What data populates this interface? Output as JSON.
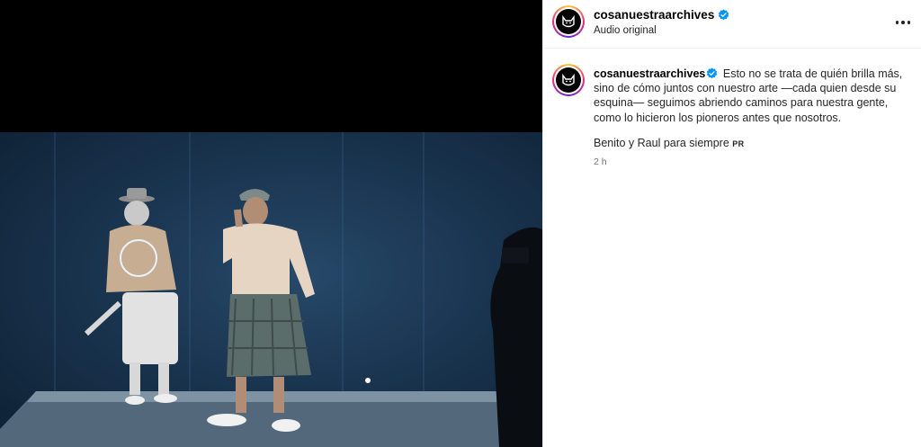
{
  "post": {
    "username": "cosanuestraarchives",
    "audio_label": "Audio original",
    "caption_text": "Esto no se trata de quién brilla más, sino de cómo juntos con nuestro arte —cada quien desde su esquina— seguimos abriendo caminos para nuestra gente, como lo hicieron los pioneros antes que nosotros.",
    "caption_line2": "Benito y Raul para siempre",
    "caption_tag": "PR",
    "timestamp": "2 h"
  },
  "icons": {
    "verified": "verified-badge-icon",
    "more": "more-options-icon",
    "avatar": "cat-logo-avatar"
  },
  "colors": {
    "verified": "#0095f6",
    "text": "#262626",
    "muted": "#737373",
    "media_bg": "#000000",
    "scene_blue": "#1a3550"
  }
}
